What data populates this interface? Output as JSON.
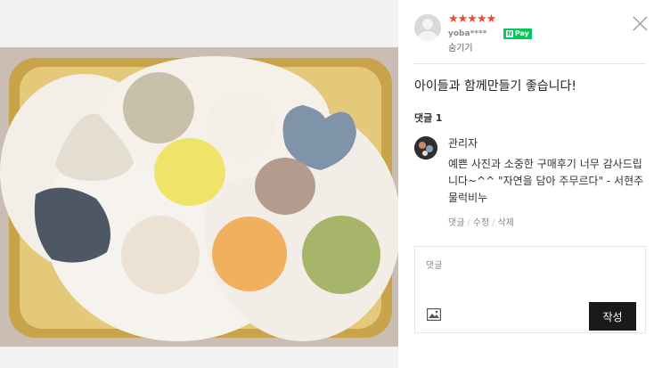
{
  "review": {
    "rating": 5,
    "stars": "★★★★★",
    "username": "yoba****",
    "pay_badge_n": "N",
    "pay_badge_label": "Pay",
    "hide_label": "숨기기",
    "text": "아이들과 함께만들기 좋습니다!"
  },
  "comments": {
    "label": "댓글",
    "count": "1",
    "items": [
      {
        "author": "관리자",
        "text": "예쁜 사진과 소중한 구매후기 너무 감사드립니다~^^ \"자연을 담아 주무르다\" - 서현주물럭비누",
        "actions": [
          "댓글",
          "수정",
          "삭제"
        ]
      }
    ]
  },
  "comment_form": {
    "placeholder": "댓글",
    "submit_label": "작성"
  },
  "icons": {
    "close": "close-icon",
    "image": "image-icon",
    "avatar": "user-avatar-icon"
  },
  "colors": {
    "star": "#f04a3a",
    "npay": "#03c75a",
    "submit": "#1a1a1a"
  }
}
